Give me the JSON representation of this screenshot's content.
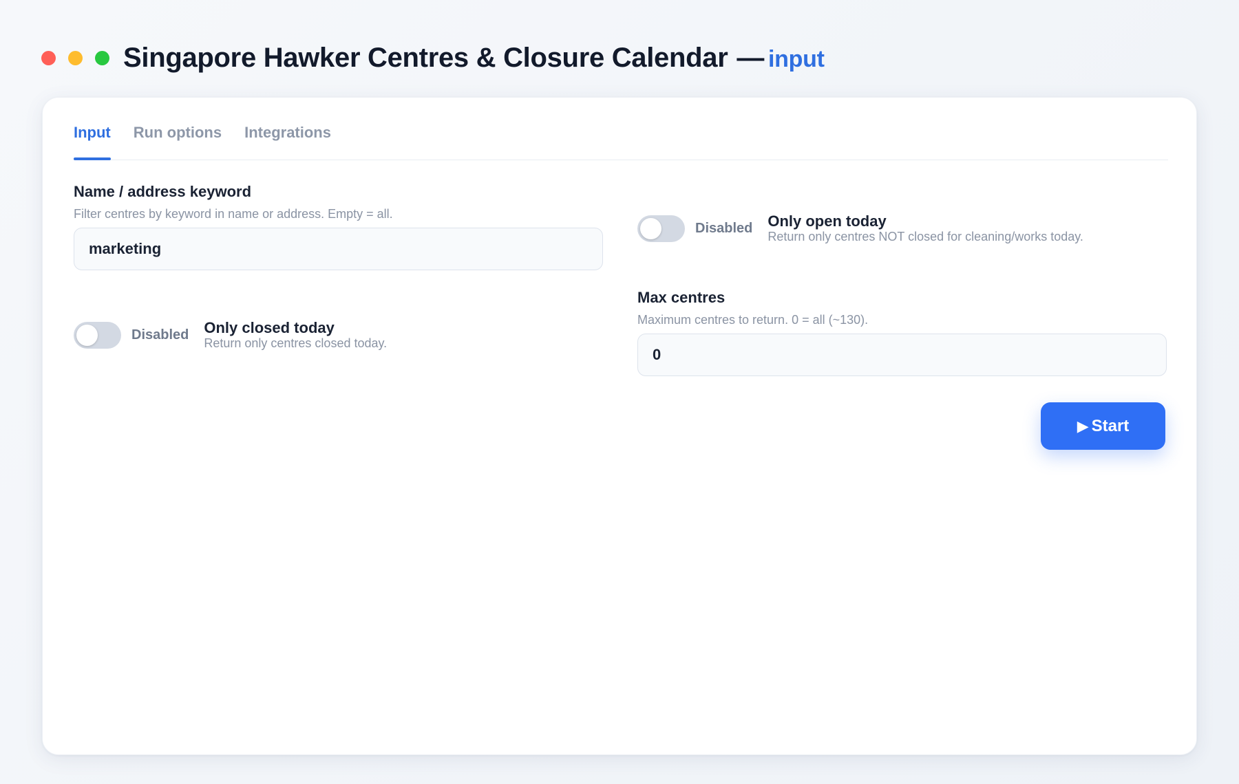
{
  "window": {
    "title": "Singapore Hawker Centres & Closure Calendar",
    "separator": "—",
    "mode": "input"
  },
  "tabs": [
    {
      "label": "Input",
      "active": true
    },
    {
      "label": "Run options",
      "active": false
    },
    {
      "label": "Integrations",
      "active": false
    }
  ],
  "keyword": {
    "label": "Name / address keyword",
    "help": "Filter centres by keyword in name or address. Empty = all.",
    "value": "marketing"
  },
  "only_closed_today": {
    "state": "Disabled",
    "enabled": false,
    "title": "Only closed today",
    "description": "Return only centres closed today."
  },
  "only_open_today": {
    "state": "Disabled",
    "enabled": false,
    "title": "Only open today",
    "description": "Return only centres NOT closed for cleaning/works today."
  },
  "max_centres": {
    "label": "Max centres",
    "help": "Maximum centres to return. 0 = all (~130).",
    "value": "0"
  },
  "start_button": {
    "icon": "play-icon",
    "glyph": "▶",
    "label": "Start"
  },
  "colors": {
    "accent": "#2f6fe0",
    "button": "#2f6ff5",
    "close": "#ff5f57",
    "minimize": "#febc2e",
    "maximize": "#28c840"
  }
}
